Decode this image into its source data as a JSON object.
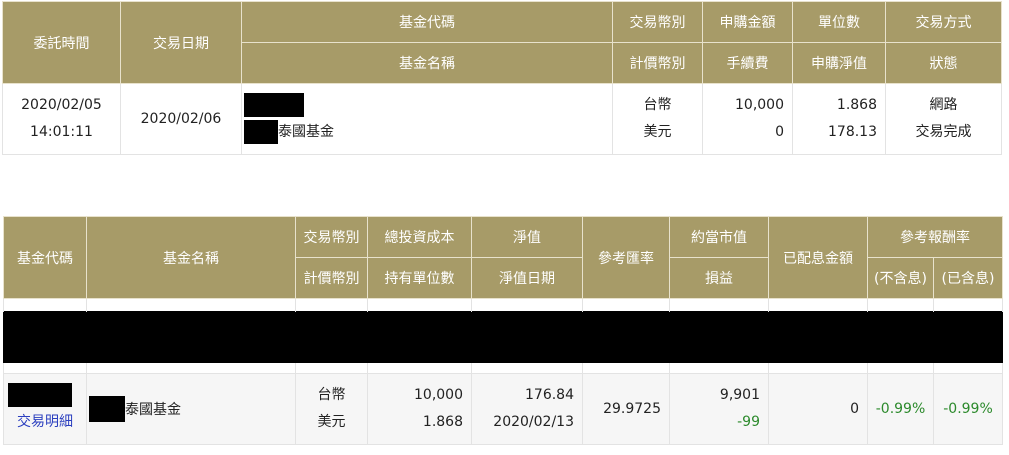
{
  "order_table": {
    "headers": {
      "order_time": "委託時間",
      "trade_date": "交易日期",
      "fund_code": "基金代碼",
      "fund_name": "基金名稱",
      "trade_currency": "交易幣別",
      "price_currency": "計價幣別",
      "subscription_amount": "申購金額",
      "fee": "手續費",
      "units": "單位數",
      "subscription_nav": "申購淨值",
      "trade_method": "交易方式",
      "status": "狀態"
    },
    "row": {
      "order_date": "2020/02/05",
      "order_time": "14:01:11",
      "trade_date": "2020/02/06",
      "fund_name": "泰國基金",
      "trade_currency": "台幣",
      "price_currency": "美元",
      "subscription_amount": "10,000",
      "fee": "0",
      "units": "1.868",
      "subscription_nav": "178.13",
      "trade_method": "網路",
      "status": "交易完成"
    }
  },
  "holdings_table": {
    "headers": {
      "fund_code": "基金代碼",
      "fund_name": "基金名稱",
      "trade_currency": "交易幣別",
      "price_currency": "計價幣別",
      "total_cost": "總投資成本",
      "held_units": "持有單位數",
      "nav": "淨值",
      "nav_date": "淨值日期",
      "ref_rate": "參考匯率",
      "market_value": "約當市值",
      "pnl": "損益",
      "dividend": "已配息金額",
      "ref_return": "參考報酬率",
      "excl_div": "(不含息)",
      "incl_div": "(已含息)"
    },
    "row": {
      "detail_link": "交易明細",
      "fund_name": "泰國基金",
      "trade_currency": "台幣",
      "price_currency": "美元",
      "total_cost": "10,000",
      "held_units": "1.868",
      "nav": "176.84",
      "nav_date": "2020/02/13",
      "ref_rate": "29.9725",
      "market_value": "9,901",
      "pnl": "-99",
      "dividend": "0",
      "return_excl": "-0.99%",
      "return_incl": "-0.99%"
    }
  },
  "colors": {
    "header_bg": "#a79b68",
    "header_text": "#ffffff",
    "positive_green": "#2c8a2c",
    "link_blue": "#2b3fbf",
    "redaction": "#000000"
  }
}
